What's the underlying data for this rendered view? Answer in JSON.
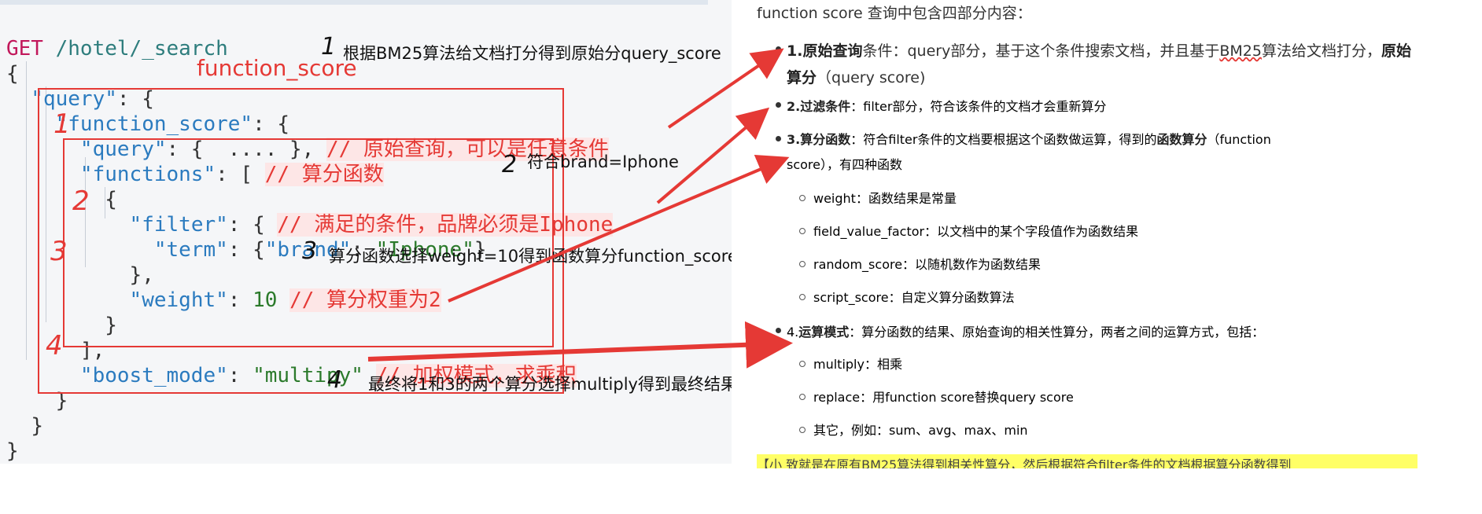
{
  "editor": {
    "method": "GET",
    "path": "/hotel/_search",
    "lines": {
      "l1": "{",
      "l2_key": "\"query\"",
      "l2_rest": ": {",
      "l3_key": "\"function_score\"",
      "l3_rest": ": {",
      "l4_key": "\"query\"",
      "l4_rest": ": {  .... },",
      "l4_comment": "// 原始查询，可以是任意条件",
      "l5_key": "\"functions\"",
      "l5_rest": ": [",
      "l5_comment": "// 算分函数",
      "l6": "{",
      "l7_key": "\"filter\"",
      "l7_rest": ": {",
      "l7_comment": "// 满足的条件，品牌必须是Iphone",
      "l8_key": "\"term\"",
      "l8_rest": ": {",
      "l8_str1": "\"brand\"",
      "l8_colon": ": ",
      "l8_str2": "\"Iphone\"",
      "l8_close": "}",
      "l9": "},",
      "l10_key": "\"weight\"",
      "l10_colon": ": ",
      "l10_num": "10",
      "l10_comment": "// 算分权重为2",
      "l11": "}",
      "l12": "],",
      "l13_key": "\"boost_mode\"",
      "l13_colon": ": ",
      "l13_str": "\"multipy\"",
      "l13_comment": "// 加权模式，求乘积",
      "l14": "}",
      "l15": "}",
      "l16": "}"
    }
  },
  "annotations": {
    "function_score_label": "function_score",
    "a1_mark": "1",
    "a1": "根据BM25算法给文档打分得到原始分query_score",
    "a2_mark": "2",
    "a2": "符合brand=Iphone",
    "a3_mark": "3",
    "a3": "算分函数选择weight=10得到函数算分function_score",
    "a4_mark": "4",
    "a4": "最终将1和3的两个算分选择multiply得到最终结果",
    "red1": "1",
    "red2": "2",
    "red3": "3",
    "red4": "4"
  },
  "doc": {
    "intro": "function score 查询中包含四部分内容：",
    "items": [
      {
        "num": "1.",
        "title": "原始查询",
        "text1": "条件：query部分，基于这个条件搜索文档，并且基于",
        "underlined": "BM25",
        "text2": "算法给文档打分，",
        "bold_end": "原始",
        "line2_bold": "算分",
        "line2": "（query score)"
      },
      {
        "num": "2.",
        "title": "过滤条件",
        "text1": "：filter部分，符合该条件的文档才会重新算分"
      },
      {
        "num": "3.",
        "title": "算分函数",
        "text1": "：符合filter条件的文档要根据这个函数做运算，得到的",
        "bold_end": "函数算分",
        "text2": "（function",
        "line2": "score），有四种函数"
      },
      {
        "num": "4.",
        "title": "运算模式",
        "text1": "：算分函数的结果、原始查询的相关性算分，两者之间的运算方式，包括："
      }
    ],
    "functions": [
      "weight：函数结果是常量",
      "field_value_factor：以文档中的某个字段值作为函数结果",
      "random_score：以随机数作为函数结果",
      "script_score：自定义算分函数算法"
    ],
    "modes": [
      "multiply：相乘",
      "replace：用function score替换query score",
      "其它，例如：sum、avg、max、min"
    ],
    "yellow_note": "【小 致就是在原有BM25算法得到相关性算分，然后根据符合filter条件的文档根据算分函数得到"
  },
  "colors": {
    "annotation_red": "#e53935",
    "highlight_yellow": "#ffff66",
    "key_blue": "#2b7bbf",
    "string_green": "#2b7a2b",
    "method_pink": "#c2185b"
  }
}
